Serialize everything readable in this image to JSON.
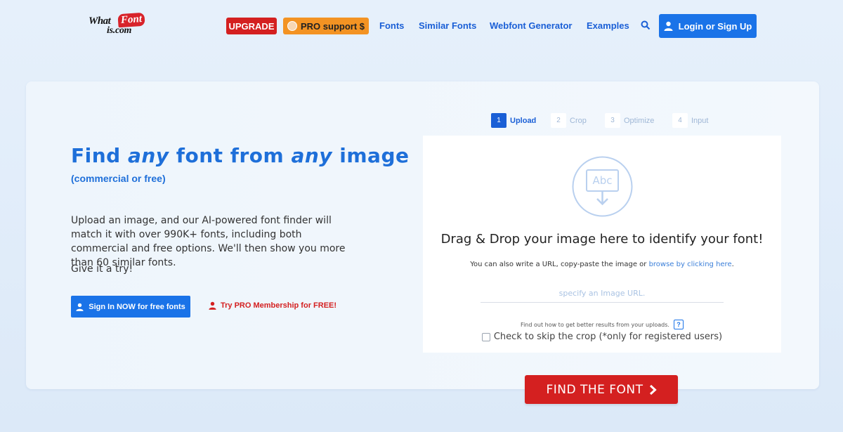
{
  "header": {
    "logo": {
      "part1": "What",
      "part2": "Font",
      "part3": "is.com"
    },
    "upgrade_label": "UPGRADE",
    "pro_support_label": "PRO support $",
    "nav": [
      {
        "label": "Fonts"
      },
      {
        "label": "Similar Fonts"
      },
      {
        "label": "Webfont Generator"
      },
      {
        "label": "Examples"
      }
    ],
    "login_label": "Login or Sign Up"
  },
  "hero": {
    "title_1": "Find ",
    "title_any1": "any",
    "title_2": " font from ",
    "title_any2": "any",
    "title_3": " image",
    "subtitle": "(commercial or free)",
    "description": "Upload an image, and our AI-powered font finder will match it with over 990K+ fonts, including both commercial and free options. We'll then show you more than 60 similar fonts.",
    "try_text": "Give it a try!",
    "signin_label": "Sign In NOW for free fonts",
    "trypro_label": "Try PRO Membership for FREE!"
  },
  "steps": [
    {
      "num": "1",
      "label": "Upload",
      "active": true
    },
    {
      "num": "2",
      "label": "Crop",
      "active": false
    },
    {
      "num": "3",
      "label": "Optimize",
      "active": false
    },
    {
      "num": "4",
      "label": "Input",
      "active": false
    }
  ],
  "upload": {
    "icon_text": "Abc",
    "title": "Drag & Drop your image here to identify your font!",
    "hint_prefix": "You can also write a URL, copy-paste the image or ",
    "hint_link": "browse by clicking here",
    "hint_suffix": ".",
    "url_placeholder": "specify an Image URL.",
    "tips_text": "Find out how to get better results from your uploads.",
    "help_label": "?",
    "skip_label": "Check to skip the crop (*only for registered users)"
  },
  "find_button_label": "FIND THE FONT",
  "colors": {
    "brand_blue": "#1a73e8",
    "brand_red": "#d42020",
    "pro_orange": "#f39323"
  }
}
